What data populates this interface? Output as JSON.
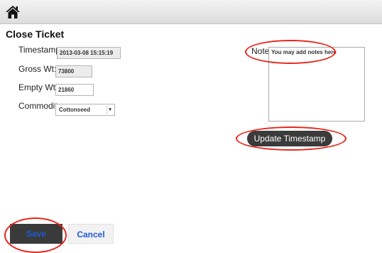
{
  "header": {
    "home_icon": "home-icon"
  },
  "page": {
    "title": "Close Ticket"
  },
  "form": {
    "timestamp_label": "Timestamp:",
    "timestamp_value": "2013-03-08 15:15:19",
    "gross_label": "Gross Wt:",
    "gross_value": "73800",
    "empty_label": "Empty Wt:",
    "empty_value": "21860",
    "commodity_label": "Commodity:",
    "commodity_value": "Cottonseed"
  },
  "note": {
    "label": "Note:",
    "value": "You may add notes here"
  },
  "actions": {
    "update_timestamp": "Update Timestamp",
    "save": "Save",
    "cancel": "Cancel"
  },
  "colors": {
    "highlight": "#e8251c",
    "link_blue": "#1f5bd6",
    "dark_button": "#3b3b3b"
  }
}
